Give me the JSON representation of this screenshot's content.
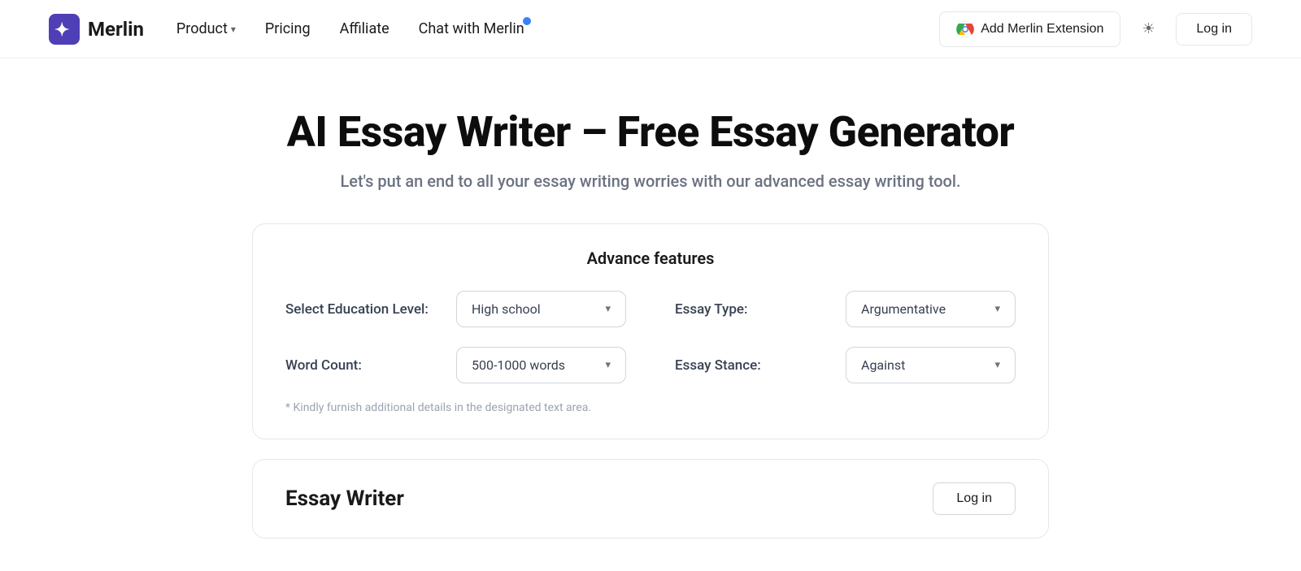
{
  "header": {
    "logo_text": "Merlin",
    "nav": {
      "product_label": "Product",
      "pricing_label": "Pricing",
      "affiliate_label": "Affiliate",
      "chat_label": "Chat with Merlin"
    },
    "chrome_btn_label": "Add Merlin Extension",
    "login_label": "Log in"
  },
  "main": {
    "title": "AI Essay Writer – Free Essay Generator",
    "subtitle": "Let's put an end to all your essay writing worries with our advanced essay writing tool.",
    "features_card": {
      "title": "Advance features",
      "education_label": "Select Education Level:",
      "education_value": "High school",
      "essay_type_label": "Essay Type:",
      "essay_type_value": "Argumentative",
      "word_count_label": "Word Count:",
      "word_count_value": "500-1000 words",
      "essay_stance_label": "Essay Stance:",
      "essay_stance_value": "Against",
      "note": "* Kindly furnish additional details in the designated text area."
    },
    "essay_writer_card": {
      "title": "Essay Writer",
      "login_label": "Log in"
    }
  }
}
